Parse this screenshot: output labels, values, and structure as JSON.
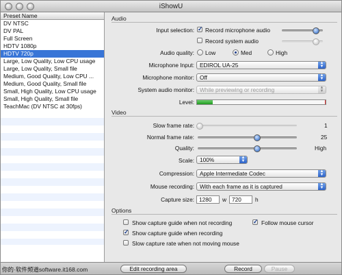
{
  "window": {
    "title": "iShowU"
  },
  "sidebar": {
    "header": "Preset Name",
    "items": [
      {
        "label": "DV NTSC"
      },
      {
        "label": "DV PAL"
      },
      {
        "label": "Full Screen"
      },
      {
        "label": "HDTV 1080p"
      },
      {
        "label": "HDTV 720p",
        "selected": true
      },
      {
        "label": "Large, Low Quality, Low CPU usage"
      },
      {
        "label": "Large, Low Quality, Small file"
      },
      {
        "label": "Medium, Good Quality, Low CPU ..."
      },
      {
        "label": "Medium, Good Quality, Small file"
      },
      {
        "label": "Small, High Quality, Low CPU usage"
      },
      {
        "label": "Small, High Quality, Small file"
      },
      {
        "label": "TeachMac (DV NTSC at 30fps)"
      }
    ]
  },
  "audio": {
    "section_label": "Audio",
    "input_selection_label": "Input selection:",
    "record_mic_label": "Record microphone audio",
    "record_mic_checked": true,
    "mic_volume_level": 0.85,
    "record_system_label": "Record system audio",
    "record_system_checked": false,
    "system_volume_level": 0.85,
    "quality_label": "Audio quality:",
    "quality_options": [
      "Low",
      "Med",
      "High"
    ],
    "quality_selected": "Med",
    "mic_input_label": "Microphone Input:",
    "mic_input_value": "EDIROL UA-25",
    "mic_monitor_label": "Microphone monitor:",
    "mic_monitor_value": "Off",
    "system_monitor_label": "System audio monitor:",
    "system_monitor_value": "While previewing or recording",
    "level_label": "Level:",
    "level_value": 0.12
  },
  "video": {
    "section_label": "Video",
    "slow_rate_label": "Slow frame rate:",
    "slow_rate_value": "1",
    "slow_rate_level": 0.0,
    "normal_rate_label": "Normal frame rate:",
    "normal_rate_value": "25",
    "normal_rate_level": 0.6,
    "quality_label": "Quality:",
    "quality_value": "High",
    "quality_level": 0.6,
    "scale_label": "Scale:",
    "scale_value": "100%",
    "compression_label": "Compression:",
    "compression_value": "Apple Intermediate Codec",
    "mouse_label": "Mouse recording:",
    "mouse_value": "With each frame as it is captured",
    "capture_size_label": "Capture size:",
    "capture_width": "1280",
    "capture_w_label": "w",
    "capture_height": "720",
    "capture_h_label": "h"
  },
  "options": {
    "section_label": "Options",
    "show_guide_not_recording": {
      "label": "Show capture guide when not recording",
      "checked": false
    },
    "follow_mouse": {
      "label": "Follow mouse cursor",
      "checked": true
    },
    "show_guide_recording": {
      "label": "Show capture guide when recording",
      "checked": true
    },
    "slow_rate_not_moving": {
      "label": "Slow capture rate when not moving mouse",
      "checked": false
    }
  },
  "bottom": {
    "watermark": "你的·软件频道software.it168.com",
    "edit_area_label": "Edit recording area",
    "record_label": "Record",
    "pause_label": "Pause"
  },
  "colors": {
    "selection": "#3875d7",
    "meter": "#1f9a1f",
    "accent": "#2d63c8"
  }
}
